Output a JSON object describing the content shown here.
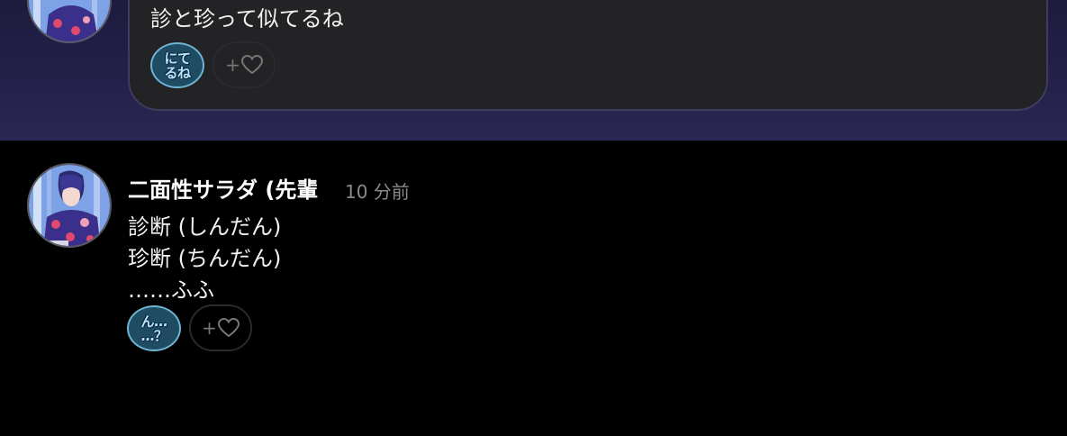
{
  "colors": {
    "page_background": "#000000",
    "highlight_band": "#24214a",
    "bubble_background": "#232325",
    "bubble_border": "#3e3c60",
    "reaction_background": "#1f4c63",
    "reaction_border": "#6fb4d4",
    "timestamp": "#8a8a8e"
  },
  "previous_message": {
    "text": "診と珍って似てるね",
    "reactions": [
      {
        "stamp_lines": [
          "にて",
          "るね"
        ],
        "icon": "custom-emoji-stamp"
      }
    ],
    "add_reaction_label": "+"
  },
  "message": {
    "username": "二面性サラダ (先輩",
    "timestamp": "10 分前",
    "lines": [
      "診断 (しんだん)",
      "珍断 (ちんだん)",
      "……ふふ"
    ],
    "reactions": [
      {
        "stamp_lines": [
          "ん…",
          "…？"
        ],
        "icon": "custom-emoji-stamp"
      }
    ],
    "add_reaction_label": "+"
  }
}
